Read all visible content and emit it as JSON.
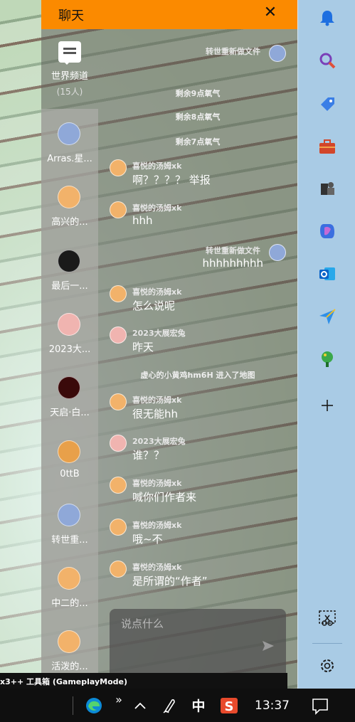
{
  "window": {
    "bottom_title": "x3++ 工具箱 (GameplayMode)"
  },
  "chat": {
    "title": "聊天",
    "close_label": "✕",
    "world_channel": {
      "name": "世界频道",
      "count": "(15人)"
    },
    "channels": [
      {
        "label": "Arras.星...",
        "avatar_color": "#8fa8d8"
      },
      {
        "label": "高兴的...",
        "avatar_color": "#f2b26a"
      },
      {
        "label": "最后一...",
        "avatar_color": "#1a1a1a"
      },
      {
        "label": "2023大...",
        "avatar_color": "#f0b4b0"
      },
      {
        "label": "天启·白...",
        "avatar_color": "#3a0a0a"
      },
      {
        "label": "0ttB",
        "avatar_color": "#e8a04a"
      },
      {
        "label": "转世重...",
        "avatar_color": "#8fa8d8"
      },
      {
        "label": "中二的...",
        "avatar_color": "#f2b26a"
      },
      {
        "label": "活泼的...",
        "avatar_color": "#f2b26a"
      }
    ],
    "messages": [
      {
        "type": "msg",
        "side": "right",
        "name": "转世重新做文件",
        "text": "",
        "avatar_color": "#8fa8d8"
      },
      {
        "type": "sys",
        "text": "剩余9点氧气"
      },
      {
        "type": "sys",
        "text": "剩余8点氧气"
      },
      {
        "type": "sys",
        "text": "剩余7点氧气"
      },
      {
        "type": "msg",
        "side": "left",
        "name": "喜悦的汤姆xk",
        "text": "啊？？？？ 举报",
        "avatar_color": "#f2b26a"
      },
      {
        "type": "msg",
        "side": "left",
        "name": "喜悦的汤姆xk",
        "text": "hhh",
        "avatar_color": "#f2b26a"
      },
      {
        "type": "msg",
        "side": "right",
        "name": "转世重新做文件",
        "text": "hhhhhhhhh",
        "avatar_color": "#8fa8d8"
      },
      {
        "type": "msg",
        "side": "left",
        "name": "喜悦的汤姆xk",
        "text": "怎么说呢",
        "avatar_color": "#f2b26a"
      },
      {
        "type": "msg",
        "side": "left",
        "name": "2023大展宏兔",
        "text": "昨天",
        "avatar_color": "#f0b4b0"
      },
      {
        "type": "sys",
        "text": "虚心的小黄鸡hm6H 进入了地图"
      },
      {
        "type": "msg",
        "side": "left",
        "name": "喜悦的汤姆xk",
        "text": "很无能hh",
        "avatar_color": "#f2b26a"
      },
      {
        "type": "msg",
        "side": "left",
        "name": "2023大展宏兔",
        "text": "谁？？",
        "avatar_color": "#f0b4b0"
      },
      {
        "type": "msg",
        "side": "left",
        "name": "喜悦的汤姆xk",
        "text": "喊你们作者来",
        "avatar_color": "#f2b26a"
      },
      {
        "type": "msg",
        "side": "left",
        "name": "喜悦的汤姆xk",
        "text": "哦~不",
        "avatar_color": "#f2b26a"
      },
      {
        "type": "msg",
        "side": "left",
        "name": "喜悦的汤姆xk",
        "text": "是所谓的“作者”",
        "avatar_color": "#f2b26a"
      }
    ],
    "input": {
      "placeholder": "说点什么",
      "value": ""
    }
  },
  "sidebar": {
    "icons": [
      "bell-icon",
      "search-icon",
      "tag-icon",
      "toolbox-icon",
      "chess-icon",
      "copilot-icon",
      "outlook-icon",
      "send-icon",
      "tree-icon",
      "add-icon",
      "snip-icon",
      "settings-icon"
    ]
  },
  "taskbar": {
    "ime_label": "中",
    "time": "13:37",
    "overflow_label": "»"
  },
  "colors": {
    "header": "#fb8a00",
    "sidebar": "#a9cbe5",
    "taskbar": "#0f0f0f"
  }
}
